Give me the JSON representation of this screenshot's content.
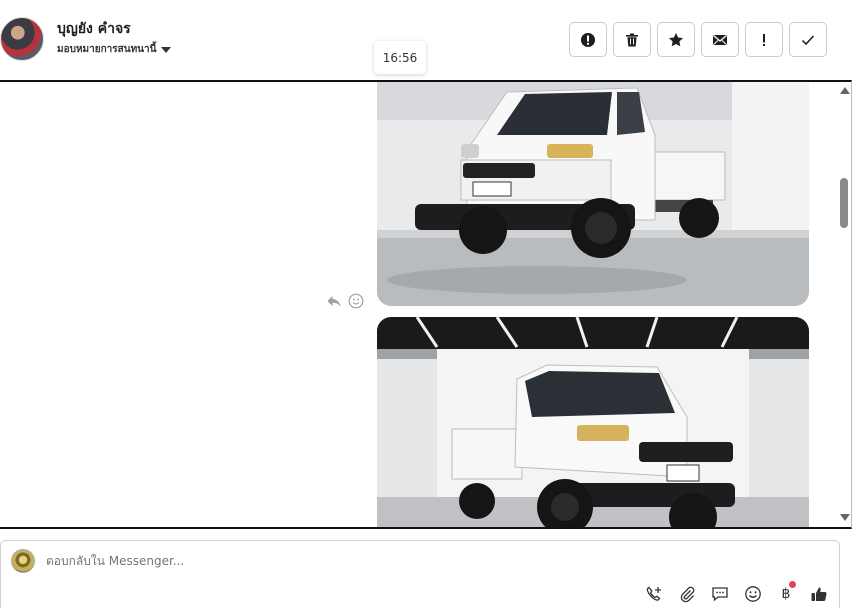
{
  "header": {
    "contact_name": "บุญยัง คำจร",
    "assign_label": "มอบหมายการสนทนานี้",
    "timestamp_tooltip": "16:56"
  },
  "toolbar": {
    "buttons": [
      {
        "name": "mark-spam",
        "icon": "exclamation-circle-icon"
      },
      {
        "name": "delete",
        "icon": "trash-icon"
      },
      {
        "name": "star",
        "icon": "star-icon"
      },
      {
        "name": "mark-unread",
        "icon": "envelope-icon"
      },
      {
        "name": "follow-up",
        "icon": "exclamation-icon"
      },
      {
        "name": "mark-done",
        "icon": "checkmark-icon"
      }
    ]
  },
  "conversation": {
    "messages": [
      {
        "type": "image",
        "description_icon": "photo-white-pickup-truck-front"
      },
      {
        "type": "image",
        "description_icon": "photo-white-pickup-truck-angle"
      }
    ],
    "actions": [
      "reply-icon",
      "emoji-react-icon"
    ]
  },
  "composer": {
    "placeholder": "ตอบกลับใน Messenger...",
    "icons": [
      "phone-add-icon",
      "paperclip-icon",
      "saved-reply-icon",
      "emoji-icon",
      "baht-payment-icon",
      "thumbs-up-icon"
    ],
    "baht_symbol": "฿"
  },
  "colors": {
    "accent": "#1c1e21",
    "notification": "#e4405f"
  }
}
